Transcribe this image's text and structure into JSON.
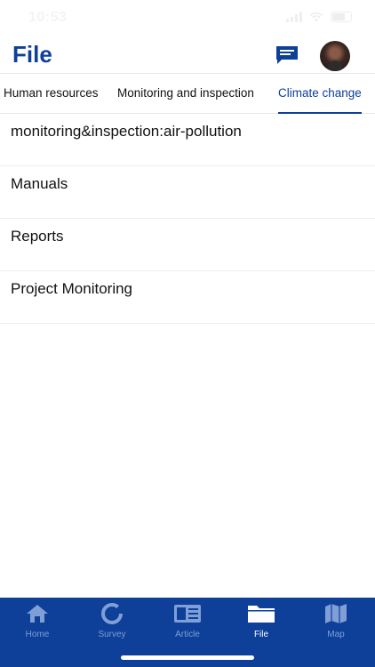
{
  "status_bar": {
    "time": "10:53"
  },
  "header": {
    "title": "File",
    "chat_icon": "chat-icon",
    "avatar_icon": "avatar"
  },
  "tabs": [
    {
      "label": "Human resources",
      "active": false
    },
    {
      "label": "Monitoring and inspection",
      "active": false
    },
    {
      "label": "Climate change",
      "active": true
    }
  ],
  "files": [
    {
      "label": "monitoring&inspection:air-pollution"
    },
    {
      "label": "Manuals"
    },
    {
      "label": "Reports"
    },
    {
      "label": "Project Monitoring"
    }
  ],
  "tab_bar": [
    {
      "label": "Home",
      "icon": "home-icon",
      "active": false
    },
    {
      "label": "Survey",
      "icon": "survey-icon",
      "active": false
    },
    {
      "label": "Article",
      "icon": "article-icon",
      "active": false
    },
    {
      "label": "File",
      "icon": "folder-icon",
      "active": true
    },
    {
      "label": "Map",
      "icon": "map-icon",
      "active": false
    }
  ],
  "colors": {
    "brand": "#0e3f99",
    "tab_inactive": "#7f9fd6",
    "background": "#ffffff"
  }
}
